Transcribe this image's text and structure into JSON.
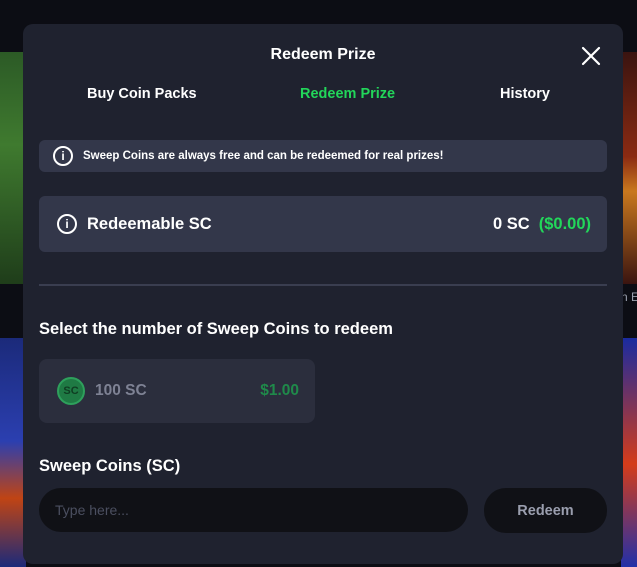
{
  "background": {
    "caption": "n E"
  },
  "modal": {
    "title": "Redeem Prize",
    "close_icon": "close-icon"
  },
  "tabs": [
    {
      "label": "Buy Coin Packs",
      "active": false
    },
    {
      "label": "Redeem Prize",
      "active": true
    },
    {
      "label": "History",
      "active": false
    }
  ],
  "info": {
    "icon": "info-icon",
    "text": "Sweep Coins are always free and can be redeemed for real prizes!"
  },
  "redeemable": {
    "icon": "info-icon",
    "label": "Redeemable SC",
    "sc_amount": "0 SC",
    "usd_amount": "($0.00)"
  },
  "select": {
    "title": "Select the number of Sweep Coins to redeem",
    "options": [
      {
        "coin_label": "SC",
        "sc": "100 SC",
        "usd": "$1.00"
      }
    ]
  },
  "sweep_coins_input": {
    "title": "Sweep Coins (SC)",
    "placeholder": "Type here...",
    "value": ""
  },
  "redeem_button": {
    "label": "Redeem"
  },
  "colors": {
    "accent_green": "#22d65a",
    "modal_bg": "#1f222f",
    "panel_bg": "#33374a"
  }
}
